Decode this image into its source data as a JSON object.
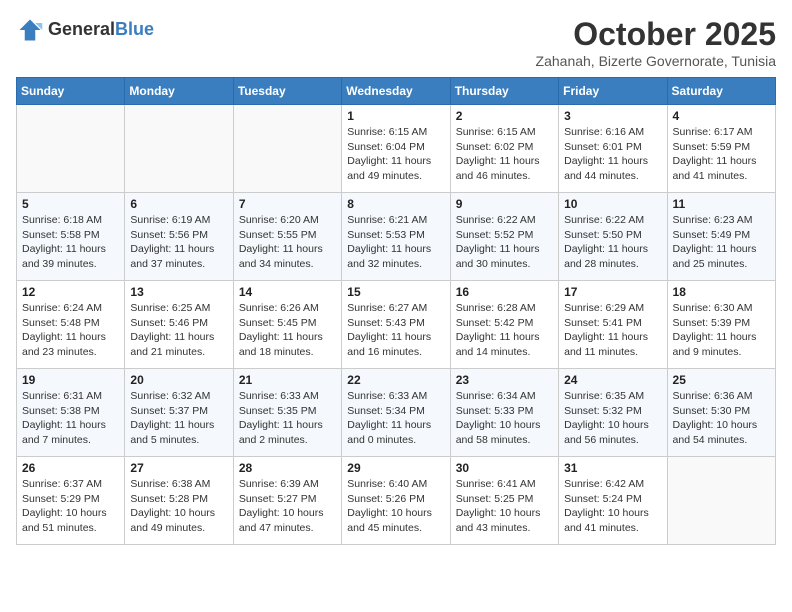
{
  "logo": {
    "general": "General",
    "blue": "Blue"
  },
  "header": {
    "month": "October 2025",
    "location": "Zahanah, Bizerte Governorate, Tunisia"
  },
  "weekdays": [
    "Sunday",
    "Monday",
    "Tuesday",
    "Wednesday",
    "Thursday",
    "Friday",
    "Saturday"
  ],
  "weeks": [
    [
      {
        "day": "",
        "info": ""
      },
      {
        "day": "",
        "info": ""
      },
      {
        "day": "",
        "info": ""
      },
      {
        "day": "1",
        "info": "Sunrise: 6:15 AM\nSunset: 6:04 PM\nDaylight: 11 hours and 49 minutes."
      },
      {
        "day": "2",
        "info": "Sunrise: 6:15 AM\nSunset: 6:02 PM\nDaylight: 11 hours and 46 minutes."
      },
      {
        "day": "3",
        "info": "Sunrise: 6:16 AM\nSunset: 6:01 PM\nDaylight: 11 hours and 44 minutes."
      },
      {
        "day": "4",
        "info": "Sunrise: 6:17 AM\nSunset: 5:59 PM\nDaylight: 11 hours and 41 minutes."
      }
    ],
    [
      {
        "day": "5",
        "info": "Sunrise: 6:18 AM\nSunset: 5:58 PM\nDaylight: 11 hours and 39 minutes."
      },
      {
        "day": "6",
        "info": "Sunrise: 6:19 AM\nSunset: 5:56 PM\nDaylight: 11 hours and 37 minutes."
      },
      {
        "day": "7",
        "info": "Sunrise: 6:20 AM\nSunset: 5:55 PM\nDaylight: 11 hours and 34 minutes."
      },
      {
        "day": "8",
        "info": "Sunrise: 6:21 AM\nSunset: 5:53 PM\nDaylight: 11 hours and 32 minutes."
      },
      {
        "day": "9",
        "info": "Sunrise: 6:22 AM\nSunset: 5:52 PM\nDaylight: 11 hours and 30 minutes."
      },
      {
        "day": "10",
        "info": "Sunrise: 6:22 AM\nSunset: 5:50 PM\nDaylight: 11 hours and 28 minutes."
      },
      {
        "day": "11",
        "info": "Sunrise: 6:23 AM\nSunset: 5:49 PM\nDaylight: 11 hours and 25 minutes."
      }
    ],
    [
      {
        "day": "12",
        "info": "Sunrise: 6:24 AM\nSunset: 5:48 PM\nDaylight: 11 hours and 23 minutes."
      },
      {
        "day": "13",
        "info": "Sunrise: 6:25 AM\nSunset: 5:46 PM\nDaylight: 11 hours and 21 minutes."
      },
      {
        "day": "14",
        "info": "Sunrise: 6:26 AM\nSunset: 5:45 PM\nDaylight: 11 hours and 18 minutes."
      },
      {
        "day": "15",
        "info": "Sunrise: 6:27 AM\nSunset: 5:43 PM\nDaylight: 11 hours and 16 minutes."
      },
      {
        "day": "16",
        "info": "Sunrise: 6:28 AM\nSunset: 5:42 PM\nDaylight: 11 hours and 14 minutes."
      },
      {
        "day": "17",
        "info": "Sunrise: 6:29 AM\nSunset: 5:41 PM\nDaylight: 11 hours and 11 minutes."
      },
      {
        "day": "18",
        "info": "Sunrise: 6:30 AM\nSunset: 5:39 PM\nDaylight: 11 hours and 9 minutes."
      }
    ],
    [
      {
        "day": "19",
        "info": "Sunrise: 6:31 AM\nSunset: 5:38 PM\nDaylight: 11 hours and 7 minutes."
      },
      {
        "day": "20",
        "info": "Sunrise: 6:32 AM\nSunset: 5:37 PM\nDaylight: 11 hours and 5 minutes."
      },
      {
        "day": "21",
        "info": "Sunrise: 6:33 AM\nSunset: 5:35 PM\nDaylight: 11 hours and 2 minutes."
      },
      {
        "day": "22",
        "info": "Sunrise: 6:33 AM\nSunset: 5:34 PM\nDaylight: 11 hours and 0 minutes."
      },
      {
        "day": "23",
        "info": "Sunrise: 6:34 AM\nSunset: 5:33 PM\nDaylight: 10 hours and 58 minutes."
      },
      {
        "day": "24",
        "info": "Sunrise: 6:35 AM\nSunset: 5:32 PM\nDaylight: 10 hours and 56 minutes."
      },
      {
        "day": "25",
        "info": "Sunrise: 6:36 AM\nSunset: 5:30 PM\nDaylight: 10 hours and 54 minutes."
      }
    ],
    [
      {
        "day": "26",
        "info": "Sunrise: 6:37 AM\nSunset: 5:29 PM\nDaylight: 10 hours and 51 minutes."
      },
      {
        "day": "27",
        "info": "Sunrise: 6:38 AM\nSunset: 5:28 PM\nDaylight: 10 hours and 49 minutes."
      },
      {
        "day": "28",
        "info": "Sunrise: 6:39 AM\nSunset: 5:27 PM\nDaylight: 10 hours and 47 minutes."
      },
      {
        "day": "29",
        "info": "Sunrise: 6:40 AM\nSunset: 5:26 PM\nDaylight: 10 hours and 45 minutes."
      },
      {
        "day": "30",
        "info": "Sunrise: 6:41 AM\nSunset: 5:25 PM\nDaylight: 10 hours and 43 minutes."
      },
      {
        "day": "31",
        "info": "Sunrise: 6:42 AM\nSunset: 5:24 PM\nDaylight: 10 hours and 41 minutes."
      },
      {
        "day": "",
        "info": ""
      }
    ]
  ]
}
